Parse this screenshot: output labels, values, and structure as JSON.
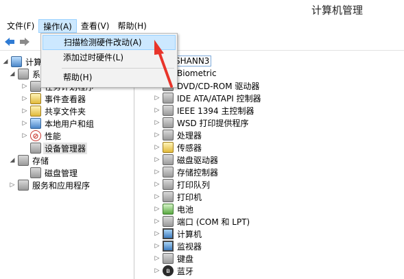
{
  "window": {
    "title": "计算机管理"
  },
  "menubar": {
    "items": [
      {
        "label": "文件(F)",
        "name": "menu-file"
      },
      {
        "label": "操作(A)",
        "name": "menu-action"
      },
      {
        "label": "查看(V)",
        "name": "menu-view"
      },
      {
        "label": "帮助(H)",
        "name": "menu-help"
      }
    ]
  },
  "toolbar": {
    "back": "back-icon",
    "forward": "forward-icon"
  },
  "dropdown": {
    "items": [
      {
        "label": "扫描检测硬件改动(A)"
      },
      {
        "label": "添加过时硬件(L)"
      },
      {
        "label": "帮助(H)"
      }
    ]
  },
  "left_tree": {
    "root": "计算机管理(本地)",
    "items": [
      {
        "label": "系统工具"
      },
      {
        "label": "任务计划程序"
      },
      {
        "label": "事件查看器"
      },
      {
        "label": "共享文件夹"
      },
      {
        "label": "本地用户和组"
      },
      {
        "label": "性能"
      },
      {
        "label": "设备管理器"
      },
      {
        "label": "存储"
      },
      {
        "label": "磁盘管理"
      },
      {
        "label": "服务和应用程序"
      }
    ]
  },
  "right_tree": {
    "root": "SHANN3",
    "items": [
      {
        "label": "Biometric"
      },
      {
        "label": "DVD/CD-ROM 驱动器"
      },
      {
        "label": "IDE ATA/ATAPI 控制器"
      },
      {
        "label": "IEEE 1394 主控制器"
      },
      {
        "label": "WSD 打印提供程序"
      },
      {
        "label": "处理器"
      },
      {
        "label": "传感器"
      },
      {
        "label": "磁盘驱动器"
      },
      {
        "label": "存储控制器"
      },
      {
        "label": "打印队列"
      },
      {
        "label": "打印机"
      },
      {
        "label": "电池"
      },
      {
        "label": "端口 (COM 和 LPT)"
      },
      {
        "label": "计算机"
      },
      {
        "label": "监视器"
      },
      {
        "label": "键盘"
      },
      {
        "label": "蓝牙"
      }
    ]
  },
  "colors": {
    "highlight": "#cce8ff",
    "arrow": "#e8342a"
  }
}
